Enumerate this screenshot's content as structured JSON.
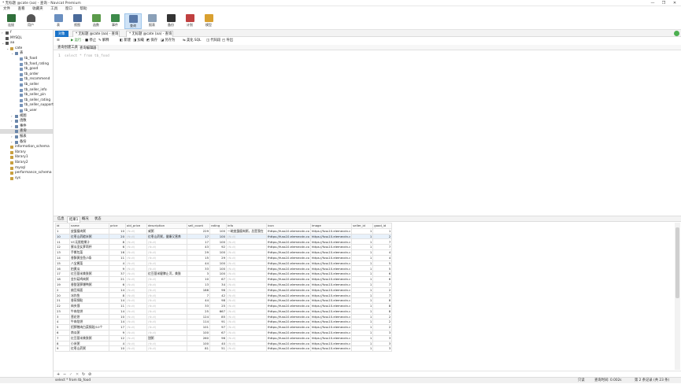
{
  "window": {
    "title": "* 无标题 @cate (aa) - 查询 - Navicat Premium",
    "controls": [
      "—",
      "❐",
      "✕"
    ]
  },
  "menu": [
    "文件",
    "查看",
    "收藏夹",
    "工具",
    "窗口",
    "帮助"
  ],
  "toolbar": [
    {
      "label": "连接",
      "icon": "connection-icon"
    },
    {
      "label": "用户",
      "icon": "user-icon"
    },
    {
      "label": "表",
      "icon": "table-icon"
    },
    {
      "label": "视图",
      "icon": "view-icon"
    },
    {
      "label": "函数",
      "icon": "function-icon"
    },
    {
      "label": "事件",
      "icon": "event-icon"
    },
    {
      "label": "查询",
      "icon": "query-icon"
    },
    {
      "label": "报表",
      "icon": "report-icon"
    },
    {
      "label": "备份",
      "icon": "backup-icon"
    },
    {
      "label": "计划",
      "icon": "schedule-icon"
    },
    {
      "label": "模型",
      "icon": "model-icon"
    }
  ],
  "tree": [
    {
      "label": "f",
      "indent": 0,
      "tw": "›"
    },
    {
      "label": "MYSQL",
      "indent": 0,
      "tw": ""
    },
    {
      "label": "aa",
      "indent": 0,
      "tw": "⌄"
    },
    {
      "label": "cate",
      "indent": 1,
      "tw": "⌄"
    },
    {
      "label": "表",
      "indent": 2,
      "tw": "⌄"
    },
    {
      "label": "tb_food",
      "indent": 3,
      "tw": ""
    },
    {
      "label": "tb_food_rating",
      "indent": 3,
      "tw": ""
    },
    {
      "label": "tb_good",
      "indent": 3,
      "tw": ""
    },
    {
      "label": "tb_order",
      "indent": 3,
      "tw": ""
    },
    {
      "label": "tb_recommend",
      "indent": 3,
      "tw": ""
    },
    {
      "label": "tb_seller",
      "indent": 3,
      "tw": ""
    },
    {
      "label": "tb_seller_info",
      "indent": 3,
      "tw": ""
    },
    {
      "label": "tb_seller_pin",
      "indent": 3,
      "tw": ""
    },
    {
      "label": "tb_seller_rating",
      "indent": 3,
      "tw": ""
    },
    {
      "label": "tb_seller_support",
      "indent": 3,
      "tw": ""
    },
    {
      "label": "tb_user",
      "indent": 3,
      "tw": ""
    },
    {
      "label": "视图",
      "indent": 2,
      "tw": "›"
    },
    {
      "label": "函数",
      "indent": 2,
      "tw": "›"
    },
    {
      "label": "事件",
      "indent": 2,
      "tw": "›"
    },
    {
      "label": "查询",
      "indent": 2,
      "tw": "",
      "selected": true
    },
    {
      "label": "报表",
      "indent": 2,
      "tw": "›"
    },
    {
      "label": "备份",
      "indent": 2,
      "tw": "›"
    },
    {
      "label": "information_schema",
      "indent": 1,
      "tw": ""
    },
    {
      "label": "library",
      "indent": 1,
      "tw": ""
    },
    {
      "label": "library1",
      "indent": 1,
      "tw": ""
    },
    {
      "label": "library2",
      "indent": 1,
      "tw": ""
    },
    {
      "label": "mysql",
      "indent": 1,
      "tw": ""
    },
    {
      "label": "performance_schema",
      "indent": 1,
      "tw": ""
    },
    {
      "label": "sys",
      "indent": 1,
      "tw": ""
    }
  ],
  "tabs": {
    "object": "对象",
    "tab1": "* 无标题 @cate (aa) - 查询",
    "tab2": "* 无标题 @cate (aa) - 查询"
  },
  "query_toolbar": [
    "☰",
    "▶ 运行 ·",
    "■ 停止",
    "✎ 解释",
    "◧ 新建",
    "◨ 加载",
    "◩ 保存",
    "◪ 另存为",
    "⇆ 美化 SQL",
    "◫ 代码段",
    "◰ 导出"
  ],
  "query_subtabs": [
    "查询创建工具",
    "查询编辑器"
  ],
  "editor": {
    "line": "1",
    "sql": "select * from tb_food"
  },
  "result_tabs": [
    "信息",
    "结果1",
    "概况",
    "状态"
  ],
  "grid": {
    "columns": [
      "id",
      "name",
      "price",
      "old_price",
      "description",
      "sell_count",
      "rating",
      "info",
      "icon",
      "image",
      "seller_id",
      "good_id"
    ],
    "null_text": "(Null)",
    "current_row": 1,
    "rows": [
      [
        "1",
        "皮蛋瘦肉粥",
        "10",
        "",
        "咸粥",
        "229",
        "100",
        "一碗皮蛋瘦肉粥，总是我在",
        "fhttps://fuss10.elemecdn.co",
        "https://fuss10.elemecdn.c",
        "1",
        "1"
      ],
      [
        "10",
        "红枣山药糙米粥",
        "20",
        "",
        "红枣山药粥，健康又营养",
        "17",
        "100",
        "(Null)",
        "fhttps://fuss10.elemecdn.co",
        "https://fuss10.elemecdn.c",
        "1",
        "2"
      ],
      [
        "11",
        "VC无限橙果汁",
        "8",
        "",
        "(Null)",
        "17",
        "100",
        "(Null)",
        "fhttps://fuss10.elemecdn.co",
        "https://fuss10.elemecdn.c",
        "1",
        "7"
      ],
      [
        "12",
        "蜜瓜圣女萝莉杯",
        "6",
        "",
        "(Null)",
        "43",
        "92",
        "(Null)",
        "fhttps://fuss10.elemecdn.co",
        "https://fuss10.elemecdn.c",
        "1",
        "7"
      ],
      [
        "13",
        "手撕包菜",
        "16",
        "",
        "(Null)",
        "29",
        "100",
        "(Null)",
        "fhttps://fuss10.elemecdn.co",
        "https://fuss10.elemecdn.c",
        "1",
        "4"
      ],
      [
        "14",
        "香酥黄金鱼/3条",
        "11",
        "",
        "(Null)",
        "15",
        "29",
        "(Null)",
        "fhttps://fuss10.elemecdn.co",
        "https://fuss10.elemecdn.c",
        "1",
        "4"
      ],
      [
        "15",
        "八宝酱菜",
        "4",
        "",
        "(Null)",
        "44",
        "100",
        "(Null)",
        "fhttps://fuss10.elemecdn.co",
        "https://fuss10.elemecdn.c",
        "1",
        "5"
      ],
      [
        "16",
        "拍黄瓜",
        "9",
        "",
        "(Null)",
        "33",
        "100",
        "(Null)",
        "fhttps://fuss10.elemecdn.co",
        "https://fuss10.elemecdn.c",
        "1",
        "5"
      ],
      [
        "17",
        "红豆薏米美肤粥",
        "37",
        "",
        "红豆薏米健脾止泻，美肤",
        "3",
        "100",
        "(Null)",
        "fhttps://fuss10.elemecdn.co",
        "https://fuss10.elemecdn.c",
        "1",
        "6"
      ],
      [
        "18",
        "金针菇鸡肉粥",
        "21",
        "",
        "(Null)",
        "10",
        "67",
        "(Null)",
        "fhttps://fuss10.elemecdn.co",
        "https://fuss10.elemecdn.c",
        "1",
        "6"
      ],
      [
        "19",
        "香甜菠萝爆鸭粥",
        "6",
        "",
        "(Null)",
        "13",
        "34",
        "(Null)",
        "fhttps://fuss10.elemecdn.co",
        "https://fuss10.elemecdn.c",
        "1",
        "7"
      ],
      [
        "2",
        "扁豆焖面",
        "14",
        "",
        "(Null)",
        "188",
        "96",
        "(Null)",
        "fhttps://fuss10.elemecdn.co",
        "https://fuss10.elemecdn.c",
        "1",
        "2"
      ],
      [
        "20",
        "冰炸鱼",
        "8",
        "",
        "(Null)",
        "7",
        "42",
        "(Null)",
        "fhttps://fuss10.elemecdn.co",
        "https://fuss10.elemecdn.c",
        "1",
        "7"
      ],
      [
        "21",
        "香煎锅贴",
        "14",
        "",
        "(Null)",
        "44",
        "98",
        "(Null)",
        "fhttps://fuss10.elemecdn.co",
        "https://fuss10.elemecdn.c",
        "1",
        "8"
      ],
      [
        "22",
        "肉夹馍",
        "11",
        "",
        "(Null)",
        "33",
        "25",
        "(Null)",
        "fhttps://fuss10.elemecdn.co",
        "https://fuss10.elemecdn.c",
        "1",
        "8"
      ],
      [
        "23",
        "牛肉馅饼",
        "14",
        "",
        "(Null)",
        "25",
        "667",
        "(Null)",
        "fhttps://fuss10.elemecdn.co",
        "https://fuss10.elemecdn.c",
        "1",
        "8"
      ],
      [
        "3",
        "葱花饼",
        "10",
        "",
        "(Null)",
        "124",
        "85",
        "(Null)",
        "fhttps://fuss10.elemecdn.co",
        "https://fuss10.elemecdn.c",
        "1",
        "2"
      ],
      [
        "4",
        "牛肉馅饼",
        "14",
        "",
        "(Null)",
        "114",
        "91",
        "(Null)",
        "fhttps://fuss10.elemecdn.co",
        "https://fuss10.elemecdn.c",
        "1",
        "2"
      ],
      [
        "5",
        "招牌猪肉白菜锅贴/10个",
        "17",
        "",
        "(Null)",
        "101",
        "97",
        "(Null)",
        "fhttps://fuss10.elemecdn.co",
        "https://fuss10.elemecdn.c",
        "1",
        "2"
      ],
      [
        "6",
        "南瓜粥",
        "9",
        "",
        "(Null)",
        "100",
        "67",
        "(Null)",
        "fhttps://fuss10.elemecdn.co",
        "https://fuss10.elemecdn.c",
        "1",
        "3"
      ],
      [
        "7",
        "红豆薏米美肤粥",
        "12",
        "",
        "甜粥",
        "260",
        "96",
        "(Null)",
        "fhttps://fuss10.elemecdn.co",
        "https://fuss10.elemecdn.c",
        "1",
        "3"
      ],
      [
        "8",
        "小米粥",
        "4",
        "",
        "(Null)",
        "100",
        "40",
        "(Null)",
        "fhttps://fuss10.elemecdn.co",
        "https://fuss10.elemecdn.c",
        "1",
        "3"
      ],
      [
        "9",
        "红枣山药粥",
        "10",
        "",
        "(Null)",
        "81",
        "51",
        "(Null)",
        "fhttps://fuss10.elemecdn.co",
        "https://fuss10.elemecdn.c",
        "1",
        "3"
      ]
    ]
  },
  "nav": [
    "+",
    "−",
    "✓",
    "✕",
    "↻",
    "⊘"
  ],
  "status": {
    "sql": "select * from tb_food",
    "readonly": "只读",
    "time": "查询时间: 0.002s",
    "records": "第 2 条记录 (共 23 条)"
  },
  "colors": {
    "accent": "#1a73c9",
    "selected_tab": "#cfe3f7"
  }
}
